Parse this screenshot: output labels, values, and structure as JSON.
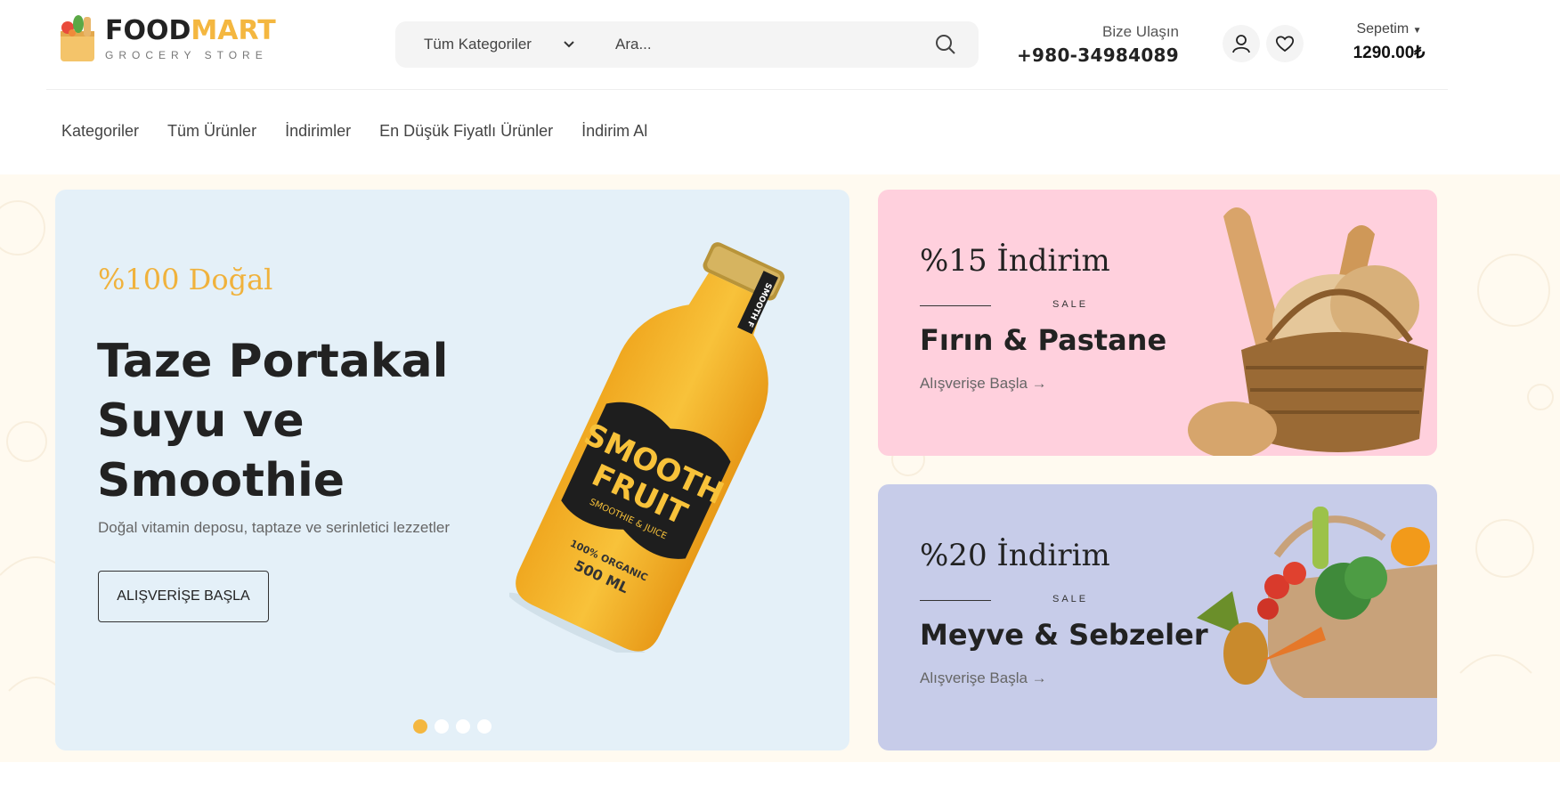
{
  "brand": {
    "name_part1": "FOOD",
    "name_part2": "MART",
    "tagline": "GROCERY STORE"
  },
  "search": {
    "category_label": "Tüm Kategoriler",
    "placeholder": "Ara..."
  },
  "contact": {
    "label": "Bize Ulaşın",
    "phone": "+980-34984089"
  },
  "cart": {
    "label": "Sepetim",
    "total": "1290.00₺"
  },
  "nav": [
    "Kategoriler",
    "Tüm Ürünler",
    "İndirimler",
    "En Düşük Fiyatlı Ürünler",
    "İndirim Al"
  ],
  "hero": {
    "tag": "%100 Doğal",
    "title": "Taze Portakal Suyu ve Smoothie",
    "description": "Doğal vitamin deposu, taptaze ve serinletici lezzetler",
    "button": "ALIŞVERİŞE BAŞLA",
    "bottle_label_1": "SMOOTH",
    "bottle_label_2": "FRUIT",
    "bottle_sub": "SMOOTHIE & JUICE",
    "bottle_organic": "100% ORGANIC",
    "bottle_volume": "500 ML",
    "bottle_cap_label": "SMOOTH F",
    "slides": 4,
    "active_slide": 1
  },
  "promos": [
    {
      "discount": "%15 İndirim",
      "sale": "SALE",
      "title": "Fırın & Pastane",
      "link": "Alışverişe Başla"
    },
    {
      "discount": "%20 İndirim",
      "sale": "SALE",
      "title": "Meyve & Sebzeler",
      "link": "Alışverişe Başla"
    }
  ],
  "colors": {
    "accent": "#f4b740",
    "hero_bg": "#e4f0f8",
    "promo1_bg": "#ffd0dd",
    "promo2_bg": "#c7cce9",
    "page_pattern_bg": "#fffaf0"
  }
}
